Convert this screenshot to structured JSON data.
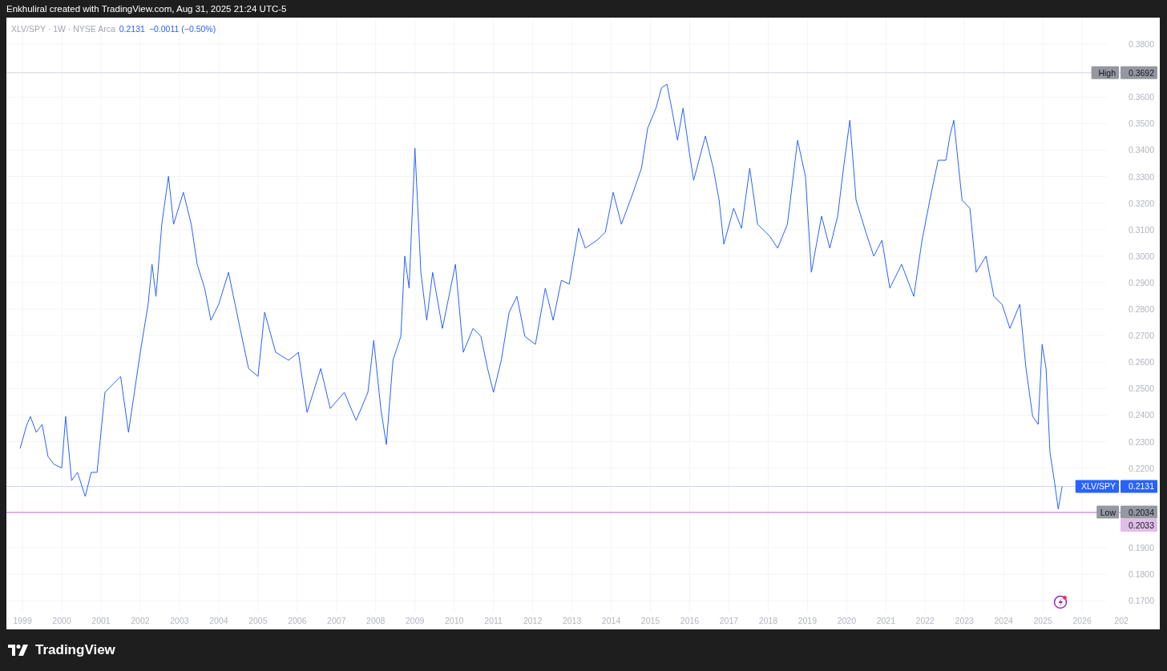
{
  "top_bar": {
    "caption": "Enkhuliral created with TradingView.com, Aug 31, 2025 21:24 UTC-5"
  },
  "legend": {
    "symbol": "XLV/SPY · 1W · NYSE Arca",
    "last": "0.2131",
    "change": "−0.0011 (−0.50%)"
  },
  "chart": {
    "chart_data": {
      "type": "line",
      "grid": true,
      "xlim": [
        1998.59,
        2026.61
      ],
      "ylim": [
        0.1655,
        0.39
      ],
      "yticks": [
        {
          "value": 0.17,
          "label": "0.1700"
        },
        {
          "value": 0.18,
          "label": "0.1800"
        },
        {
          "value": 0.19,
          "label": "0.1900"
        },
        {
          "value": 0.22,
          "label": "0.2200"
        },
        {
          "value": 0.23,
          "label": "0.2300"
        },
        {
          "value": 0.24,
          "label": "0.2400"
        },
        {
          "value": 0.25,
          "label": "0.2500"
        },
        {
          "value": 0.26,
          "label": "0.2600"
        },
        {
          "value": 0.27,
          "label": "0.2700"
        },
        {
          "value": 0.28,
          "label": "0.2800"
        },
        {
          "value": 0.29,
          "label": "0.2900"
        },
        {
          "value": 0.3,
          "label": "0.3000"
        },
        {
          "value": 0.31,
          "label": "0.3100"
        },
        {
          "value": 0.32,
          "label": "0.3200"
        },
        {
          "value": 0.33,
          "label": "0.3300"
        },
        {
          "value": 0.34,
          "label": "0.3400"
        },
        {
          "value": 0.35,
          "label": "0.3500"
        },
        {
          "value": 0.36,
          "label": "0.3600"
        },
        {
          "value": 0.38,
          "label": "0.3800"
        }
      ],
      "xticks": [
        {
          "value": 1999,
          "label": "1999"
        },
        {
          "value": 2000,
          "label": "2000"
        },
        {
          "value": 2001,
          "label": "2001"
        },
        {
          "value": 2002,
          "label": "2002"
        },
        {
          "value": 2003,
          "label": "2003"
        },
        {
          "value": 2004,
          "label": "2004"
        },
        {
          "value": 2005,
          "label": "2005"
        },
        {
          "value": 2006,
          "label": "2006"
        },
        {
          "value": 2007,
          "label": "2007"
        },
        {
          "value": 2008,
          "label": "2008"
        },
        {
          "value": 2009,
          "label": "2009"
        },
        {
          "value": 2010,
          "label": "2010"
        },
        {
          "value": 2011,
          "label": "2011"
        },
        {
          "value": 2012,
          "label": "2012"
        },
        {
          "value": 2013,
          "label": "2013"
        },
        {
          "value": 2014,
          "label": "2014"
        },
        {
          "value": 2015,
          "label": "2015"
        },
        {
          "value": 2016,
          "label": "2016"
        },
        {
          "value": 2017,
          "label": "2017"
        },
        {
          "value": 2018,
          "label": "2018"
        },
        {
          "value": 2019,
          "label": "2019"
        },
        {
          "value": 2020,
          "label": "2020"
        },
        {
          "value": 2021,
          "label": "2021"
        },
        {
          "value": 2022,
          "label": "2022"
        },
        {
          "value": 2023,
          "label": "2023"
        },
        {
          "value": 2024,
          "label": "2024"
        },
        {
          "value": 2025,
          "label": "2025"
        },
        {
          "value": 2026,
          "label": "2026"
        }
      ],
      "x": [
        1998.94,
        1999.1,
        1999.2,
        1999.35,
        1999.5,
        1999.65,
        1999.8,
        2000,
        2000.1,
        2000.25,
        2000.4,
        2000.6,
        2000.75,
        2000.9,
        2001.1,
        2001.3,
        2001.5,
        2001.7,
        2001.85,
        2002,
        2002.2,
        2002.3,
        2002.4,
        2002.55,
        2002.72,
        2002.85,
        2003.1,
        2003.3,
        2003.45,
        2003.64,
        2003.8,
        2004,
        2004.25,
        2004.5,
        2004.76,
        2005,
        2005.17,
        2005.45,
        2005.78,
        2006.03,
        2006.25,
        2006.6,
        2006.84,
        2007.2,
        2007.5,
        2007.8,
        2007.95,
        2008.13,
        2008.27,
        2008.44,
        2008.64,
        2008.74,
        2008.85,
        2009,
        2009.15,
        2009.3,
        2009.45,
        2009.7,
        2010.03,
        2010.23,
        2010.48,
        2010.68,
        2010.85,
        2011,
        2011.2,
        2011.4,
        2011.6,
        2011.8,
        2012.07,
        2012.32,
        2012.52,
        2012.73,
        2012.93,
        2013.17,
        2013.34,
        2013.64,
        2013.85,
        2014.05,
        2014.26,
        2014.56,
        2014.77,
        2014.93,
        2015.14,
        2015.28,
        2015.42,
        2015.54,
        2015.69,
        2015.83,
        2015.99,
        2016.1,
        2016.4,
        2016.6,
        2016.75,
        2016.87,
        2017.12,
        2017.32,
        2017.53,
        2017.73,
        2018.04,
        2018.24,
        2018.49,
        2018.75,
        2018.95,
        2019.1,
        2019.36,
        2019.57,
        2019.77,
        2019.92,
        2020.08,
        2020.24,
        2020.49,
        2020.69,
        2020.9,
        2021.1,
        2021.4,
        2021.71,
        2021.92,
        2022.12,
        2022.33,
        2022.53,
        2022.63,
        2022.73,
        2022.94,
        2023.14,
        2023.3,
        2023.55,
        2023.75,
        2023.96,
        2024.16,
        2024.41,
        2024.57,
        2024.74,
        2024.88,
        2024.98,
        2025.08,
        2025.18,
        2025.29,
        2025.39,
        2025.49
      ],
      "series": [
        {
          "name": "XLV/SPY",
          "color": "#2962ff",
          "values": [
            0.2274,
            0.236,
            0.2395,
            0.2335,
            0.2365,
            0.2244,
            0.2215,
            0.22,
            0.2395,
            0.2153,
            0.2184,
            0.2093,
            0.2184,
            0.2184,
            0.2486,
            0.2516,
            0.2546,
            0.2335,
            0.2485,
            0.2637,
            0.2818,
            0.2969,
            0.2848,
            0.3121,
            0.3301,
            0.312,
            0.3241,
            0.312,
            0.2969,
            0.2879,
            0.2758,
            0.2818,
            0.2939,
            0.2758,
            0.2576,
            0.2546,
            0.2788,
            0.2637,
            0.2607,
            0.2637,
            0.241,
            0.2576,
            0.2425,
            0.2486,
            0.238,
            0.2486,
            0.2682,
            0.2425,
            0.2289,
            0.2607,
            0.2697,
            0.3,
            0.2879,
            0.3407,
            0.2939,
            0.2758,
            0.2939,
            0.2727,
            0.2969,
            0.2637,
            0.2727,
            0.2697,
            0.2576,
            0.2486,
            0.2607,
            0.2788,
            0.2848,
            0.2697,
            0.2667,
            0.2879,
            0.2758,
            0.2909,
            0.2894,
            0.3105,
            0.303,
            0.306,
            0.309,
            0.3241,
            0.312,
            0.3241,
            0.3332,
            0.3483,
            0.3558,
            0.3634,
            0.3649,
            0.3558,
            0.3437,
            0.3558,
            0.3392,
            0.3286,
            0.3453,
            0.3332,
            0.3211,
            0.3045,
            0.3181,
            0.3105,
            0.3332,
            0.312,
            0.3075,
            0.303,
            0.312,
            0.3437,
            0.3301,
            0.2939,
            0.3151,
            0.303,
            0.3151,
            0.3332,
            0.3513,
            0.3211,
            0.309,
            0.3,
            0.306,
            0.2879,
            0.2969,
            0.2848,
            0.306,
            0.3211,
            0.3362,
            0.3362,
            0.3453,
            0.3513,
            0.3211,
            0.3181,
            0.2939,
            0.3,
            0.2848,
            0.2818,
            0.2727,
            0.2818,
            0.2576,
            0.2395,
            0.2365,
            0.2667,
            0.2576,
            0.2259,
            0.2153,
            0.2045,
            0.2131
          ]
        }
      ],
      "ref_lines": [
        {
          "axis": "y",
          "value": 0.3692,
          "label": "0.3692",
          "color": "#d1d4dc"
        },
        {
          "axis": "y",
          "value": 0.2131,
          "label": "0.2131",
          "color": "#c7d5ff"
        },
        {
          "axis": "y",
          "value": 0.2034,
          "label": "0.2034",
          "color": "#e3e4e8"
        },
        {
          "axis": "y",
          "value": 0.2033,
          "label": "0.2033",
          "color": "#d99be5"
        }
      ]
    },
    "cut_year_label": "202",
    "price_badges": [
      {
        "kind": "high",
        "tag": "High",
        "color": "#9598a1"
      },
      {
        "kind": "last",
        "color": "#2962ff"
      },
      {
        "kind": "low",
        "tag": "Low",
        "color": "#9598a1"
      },
      {
        "kind": "line",
        "color": "#e1bee7"
      }
    ]
  },
  "footer": {
    "brand": "TradingView"
  }
}
